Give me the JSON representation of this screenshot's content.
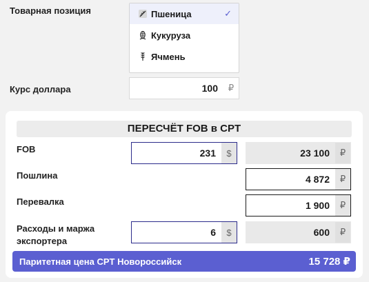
{
  "commodity": {
    "label": "Товарная позиция",
    "options": [
      {
        "label": "Пшеница",
        "icon": "wheat-icon",
        "selected": true
      },
      {
        "label": "Кукуруза",
        "icon": "corn-icon",
        "selected": false
      },
      {
        "label": "Ячмень",
        "icon": "barley-icon",
        "selected": false
      }
    ],
    "check_glyph": "✓"
  },
  "exchange_rate": {
    "label": "Курс доллара",
    "value": "100",
    "currency": "₽"
  },
  "recalc": {
    "title": "ПЕРЕСЧЁТ FOB в CPT",
    "rows": {
      "fob": {
        "label": "FOB",
        "input": "231",
        "input_currency": "$",
        "output": "23 100",
        "output_currency": "₽"
      },
      "duty": {
        "label": "Пошлина",
        "output": "4 872",
        "output_currency": "₽"
      },
      "transshipment": {
        "label": "Перевалка",
        "output": "1 900",
        "output_currency": "₽"
      },
      "margin": {
        "label_line1": "Расходы и маржа",
        "label_line2": "экспортера",
        "input": "6",
        "input_currency": "$",
        "output": "600",
        "output_currency": "₽"
      }
    },
    "result": {
      "label": "Паритетная цена CPT Новороссийск",
      "value": "15 728 ₽"
    }
  },
  "colors": {
    "accent": "#5b5fd1",
    "active_border": "#2a2a8a",
    "card_bg": "#ffffff",
    "page_bg": "#f2f2f2"
  }
}
